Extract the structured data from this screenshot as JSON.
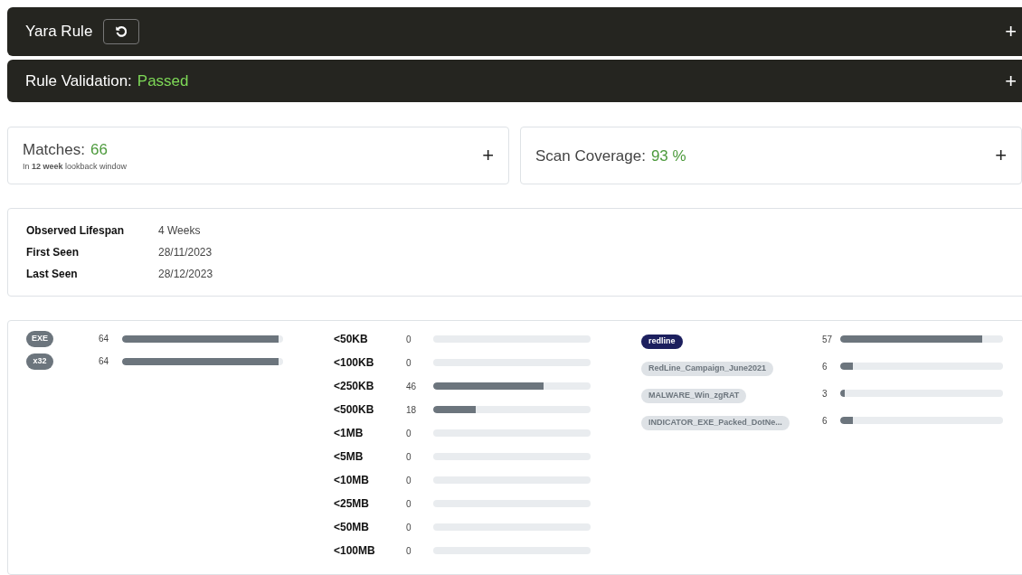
{
  "header": {
    "title": "Yara Rule"
  },
  "validation": {
    "label": "Rule Validation:",
    "status": "Passed",
    "expand": "+"
  },
  "header_expand": "+",
  "matches": {
    "label": "Matches:",
    "value": "66",
    "note": "In **12 week** lookback window",
    "expand": "+"
  },
  "coverage": {
    "label": "Scan Coverage:",
    "value": "93 %",
    "expand": "+"
  },
  "details": [
    {
      "label": "Observed Lifespan",
      "value": "4 Weeks"
    },
    {
      "label": "First Seen",
      "value": "28/11/2023"
    },
    {
      "label": "Last Seen",
      "value": "28/12/2023"
    }
  ],
  "file_types": [
    {
      "label": "EXE",
      "count": "64",
      "level": 0.97
    },
    {
      "label": "x32",
      "count": "64",
      "level": 0.97
    }
  ],
  "file_sizes": [
    {
      "label": "<50KB",
      "count": "0"
    },
    {
      "label": "<100KB",
      "count": "0"
    },
    {
      "label": "<250KB",
      "count": "46",
      "level": 0.7
    },
    {
      "label": "<500KB",
      "count": "18",
      "level": 0.27
    },
    {
      "label": "<1MB",
      "count": "0"
    },
    {
      "label": "<5MB",
      "count": "0"
    },
    {
      "label": "<10MB",
      "count": "0"
    },
    {
      "label": "<25MB",
      "count": "0"
    },
    {
      "label": "<50MB",
      "count": "0"
    },
    {
      "label": "<100MB",
      "count": "0"
    }
  ],
  "tags": [
    {
      "label": "redline",
      "kind": "primary",
      "count": "57",
      "level": 0.87
    },
    {
      "label": "RedLine_Campaign_June2021",
      "kind": "secondary",
      "count": "6",
      "level": 0.08
    },
    {
      "label": "MALWARE_Win_zgRAT",
      "kind": "secondary",
      "count": "3",
      "level": 0.03
    },
    {
      "label": "INDICATOR_EXE_Packed_DotNe...",
      "kind": "secondary",
      "count": "6",
      "level": 0.08
    }
  ]
}
